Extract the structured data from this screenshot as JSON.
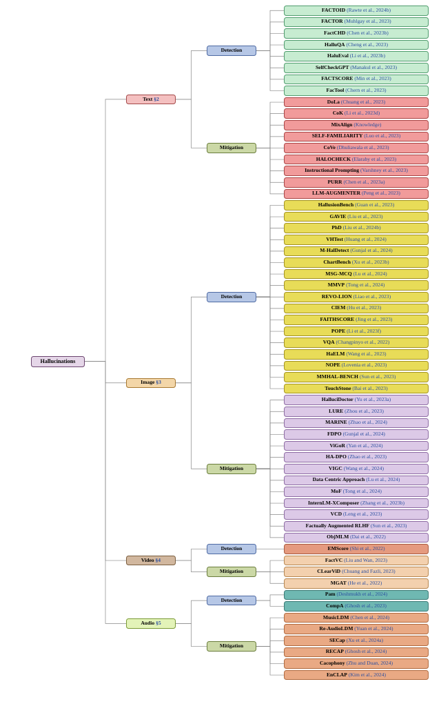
{
  "chart_data": {
    "type": "tree",
    "layout": "horizontal",
    "root": "Hallucinations",
    "children": [
      {
        "name": "Text",
        "section": "§2",
        "children": [
          {
            "name": "Detection",
            "leaves": [
              {
                "name": "FACTOID",
                "cite": "(Rawte et al., 2024b)"
              },
              {
                "name": "FACTOR",
                "cite": "(Muhlgay et al., 2023)"
              },
              {
                "name": "FactCHD",
                "cite": "(Chen et al., 2023b)"
              },
              {
                "name": "HalluQA",
                "cite": "(Cheng et al., 2023)"
              },
              {
                "name": "HaluEval",
                "cite": "(Li et al., 2023b)"
              },
              {
                "name": "SelfCheckGPT",
                "cite": "(Manakul et al., 2023)"
              },
              {
                "name": "FACTSCORE",
                "cite": "(Min et al., 2023)"
              },
              {
                "name": "FacTool",
                "cite": "(Chern et al., 2023)"
              }
            ]
          },
          {
            "name": "Mitigation",
            "leaves": [
              {
                "name": "DoLa",
                "cite": "(Chuang et al., 2023)"
              },
              {
                "name": "CoK",
                "cite": "(Li et al., 2023d)"
              },
              {
                "name": "MixAlign",
                "cite": "(Knowledge)"
              },
              {
                "name": "SELF-FAMILIARITY",
                "cite": "(Luo et al., 2023)"
              },
              {
                "name": "CoVe",
                "cite": "(Dhuliawala et al., 2023)"
              },
              {
                "name": "HALOCHECK",
                "cite": "(Elaraby et al., 2023)"
              },
              {
                "name": "Instructional Prompting",
                "cite": "(Varshney et al., 2023)"
              },
              {
                "name": "PURR",
                "cite": "(Chen et al., 2023a)"
              },
              {
                "name": "LLM-AUGMENTER",
                "cite": "(Peng et al., 2023)"
              }
            ]
          }
        ]
      },
      {
        "name": "Image",
        "section": "§3",
        "children": [
          {
            "name": "Detection",
            "leaves": [
              {
                "name": "HallusionBench",
                "cite": "(Guan et al., 2023)"
              },
              {
                "name": "GAVIE",
                "cite": "(Liu et al., 2023)"
              },
              {
                "name": "PhD",
                "cite": "(Liu et al., 2024b)"
              },
              {
                "name": "VHTest",
                "cite": "(Huang et al., 2024)"
              },
              {
                "name": "M-HalDetect",
                "cite": "(Gunjal et al., 2024)"
              },
              {
                "name": "ChartBench",
                "cite": "(Xu et al., 2023b)"
              },
              {
                "name": "MSG-MCQ",
                "cite": "(Lu et al., 2024)"
              },
              {
                "name": "MMVP",
                "cite": "(Tong et al., 2024)"
              },
              {
                "name": "REVO-LION",
                "cite": "(Liao et al., 2023)"
              },
              {
                "name": "CIEM",
                "cite": "(Hu et al., 2023)"
              },
              {
                "name": "FAITHSCORE",
                "cite": "(Jing et al., 2023)"
              },
              {
                "name": "POPE",
                "cite": "(Li et al., 2023f)"
              },
              {
                "name": "VQA",
                "cite": "(Changpinyo et al., 2022)"
              },
              {
                "name": "HaELM",
                "cite": "(Wang et al., 2023)"
              },
              {
                "name": "NOPE",
                "cite": "(Lovenia et al., 2023)"
              },
              {
                "name": "MMHAL-BENCH",
                "cite": "(Sun et al., 2023)"
              },
              {
                "name": "TouchStone",
                "cite": "(Bai et al., 2023)"
              }
            ]
          },
          {
            "name": "Mitigation",
            "leaves": [
              {
                "name": "HalluciDoctor",
                "cite": "(Yu et al., 2023a)"
              },
              {
                "name": "LURE",
                "cite": "(Zhou et al., 2023)"
              },
              {
                "name": "MARINE",
                "cite": "(Zhao et al., 2024)"
              },
              {
                "name": "FDPO",
                "cite": "(Gunjal et al., 2024)"
              },
              {
                "name": "ViGoR",
                "cite": "(Yan et al., 2024)"
              },
              {
                "name": "HA-DPO",
                "cite": "(Zhao et al., 2023)"
              },
              {
                "name": "VIGC",
                "cite": "(Wang et al., 2024)"
              },
              {
                "name": "Data Centric Approach",
                "cite": "(Lu et al., 2024)"
              },
              {
                "name": "MoF",
                "cite": "(Tong et al., 2024)"
              },
              {
                "name": "InternLM-XComposer",
                "cite": "(Zhang et al., 2023b)"
              },
              {
                "name": "VCD",
                "cite": "(Leng et al., 2023)"
              },
              {
                "name": "Factually Augmented RLHF",
                "cite": "(Sun et al., 2023)"
              },
              {
                "name": "ObjMLM",
                "cite": "(Dai et al., 2022)"
              }
            ]
          }
        ]
      },
      {
        "name": "Video",
        "section": "§4",
        "children": [
          {
            "name": "Detection",
            "leaves": [
              {
                "name": "EMScore",
                "cite": "(Shi et al., 2022)"
              }
            ]
          },
          {
            "name": "Mitigation",
            "leaves": [
              {
                "name": "FactVC",
                "cite": "(Liu and Wan, 2023)"
              },
              {
                "name": "CLearViD",
                "cite": "(Chuang and Fazli, 2023)"
              },
              {
                "name": "MGAT",
                "cite": "(He et al., 2022)"
              }
            ]
          }
        ]
      },
      {
        "name": "Audio",
        "section": "§5",
        "children": [
          {
            "name": "Detection",
            "leaves": [
              {
                "name": "Pam",
                "cite": "(Deshmukh et al., 2024)"
              },
              {
                "name": "CompA",
                "cite": "(Ghosh et al., 2023)"
              }
            ]
          },
          {
            "name": "Mitigation",
            "leaves": [
              {
                "name": "MusicLDM",
                "cite": "(Chen et al., 2024)"
              },
              {
                "name": "Re-AudioLDM",
                "cite": "(Yuan et al., 2024)"
              },
              {
                "name": "SECap",
                "cite": "(Xu et al., 2024a)"
              },
              {
                "name": "RECAP",
                "cite": "(Ghosh et al., 2024)"
              },
              {
                "name": "Cacophony",
                "cite": "(Zhu and Duan, 2024)"
              },
              {
                "name": "EnCLAP",
                "cite": "(Kim et al., 2024)"
              }
            ]
          }
        ]
      }
    ]
  },
  "cat_labels": {
    "det": "Detection",
    "mit": "Mitigation"
  },
  "root_label": "Hallucinations"
}
